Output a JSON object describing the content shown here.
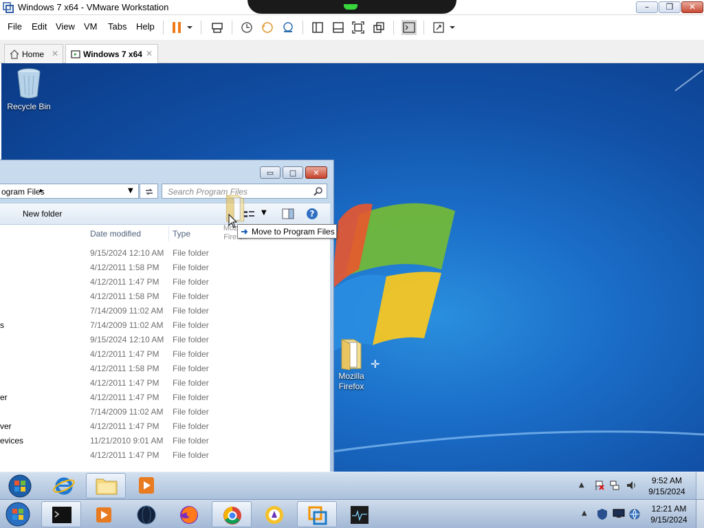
{
  "vmware": {
    "title": "Windows 7 x64 - VMware Workstation",
    "menu": [
      "File",
      "Edit",
      "View",
      "VM",
      "Tabs",
      "Help"
    ],
    "tabs": [
      {
        "label": "Home",
        "active": false
      },
      {
        "label": "Windows 7 x64",
        "active": true
      }
    ],
    "window_controls": {
      "minimize": "–",
      "maximize": "❐",
      "close": "✕"
    }
  },
  "desktop": {
    "icons": [
      {
        "label": "Recycle Bin",
        "icon": "recycle-bin-icon"
      },
      {
        "label": "Mozilla Firefox",
        "icon": "folder-icon"
      }
    ]
  },
  "explorer": {
    "address": "ogram Files",
    "search_placeholder": "Search Program Files",
    "new_folder_label": "New folder",
    "columns": {
      "date": "Date modified",
      "type": "Type"
    },
    "rows": [
      {
        "name": "",
        "date": "9/15/2024 12:10 AM",
        "type": "File folder"
      },
      {
        "name": "",
        "date": "4/12/2011 1:58 PM",
        "type": "File folder"
      },
      {
        "name": "",
        "date": "4/12/2011 1:47 PM",
        "type": "File folder"
      },
      {
        "name": "",
        "date": "4/12/2011 1:58 PM",
        "type": "File folder"
      },
      {
        "name": "",
        "date": "7/14/2009 11:02 AM",
        "type": "File folder"
      },
      {
        "name": "s",
        "date": "7/14/2009 11:02 AM",
        "type": "File folder"
      },
      {
        "name": "",
        "date": "9/15/2024 12:10 AM",
        "type": "File folder"
      },
      {
        "name": "",
        "date": "4/12/2011 1:47 PM",
        "type": "File folder"
      },
      {
        "name": "",
        "date": "4/12/2011 1:58 PM",
        "type": "File folder"
      },
      {
        "name": "",
        "date": "4/12/2011 1:47 PM",
        "type": "File folder"
      },
      {
        "name": "er",
        "date": "4/12/2011 1:47 PM",
        "type": "File folder"
      },
      {
        "name": "",
        "date": "7/14/2009 11:02 AM",
        "type": "File folder"
      },
      {
        "name": "ver",
        "date": "4/12/2011 1:47 PM",
        "type": "File folder"
      },
      {
        "name": "evices",
        "date": "11/21/2010 9:01 AM",
        "type": "File folder"
      },
      {
        "name": "",
        "date": "4/12/2011 1:47 PM",
        "type": "File folder"
      }
    ],
    "drag_label": "Mozilla Firefox",
    "tooltip": "Move to Program Files"
  },
  "guest_taskbar": {
    "time": "9:52 AM",
    "date": "9/15/2024",
    "tray_up": "▲"
  },
  "host_taskbar": {
    "time": "12:21 AM",
    "date": "9/15/2024",
    "tray_up": "▲"
  }
}
